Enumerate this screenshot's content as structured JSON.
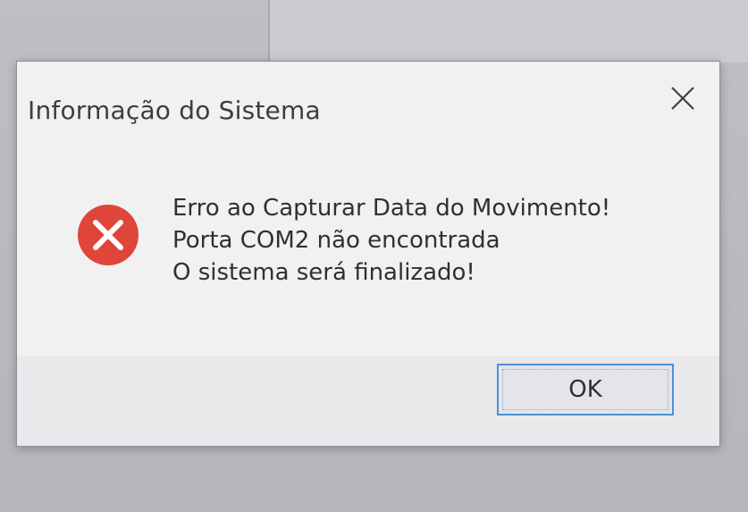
{
  "dialog": {
    "title": "Informação do Sistema",
    "close_icon": "close-icon",
    "icon": "error-icon",
    "message_lines": [
      "Erro ao Capturar Data do Movimento!",
      "Porta COM2 não encontrada",
      "O sistema será finalizado!"
    ],
    "ok_label": "OK"
  },
  "colors": {
    "error_red": "#e0453a",
    "focus_border": "#4f8fd6"
  }
}
